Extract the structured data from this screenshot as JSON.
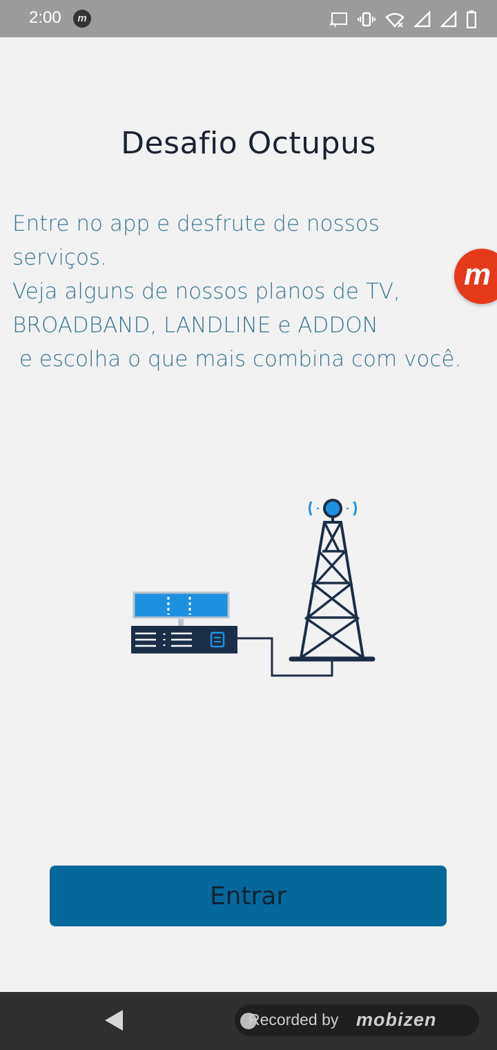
{
  "status_bar": {
    "time": "2:00",
    "app_icon_letter": "m",
    "icons": [
      "cast-icon",
      "vibrate-icon",
      "wifi-icon",
      "signal-icon",
      "signal-icon-2",
      "battery-icon"
    ]
  },
  "main": {
    "title": "Desafio Octupus",
    "description": "Entre no app e desfrute de nossos serviços.\nVeja alguns de nossos planos de TV, BROADBAND, LANDLINE e ADDON\n e escolha o que mais combina com você."
  },
  "floating_button": {
    "letter": "m"
  },
  "enter_button": {
    "label": "Entrar"
  },
  "nav_bar": {
    "recorded_label": "Recorded by",
    "recorded_brand": "mobizen"
  },
  "colors": {
    "accent": "#05689a",
    "text_primary": "#1a2333",
    "text_description": "#3a7690",
    "tower_dark": "#1c2e47",
    "tower_light": "#1e90e0"
  }
}
